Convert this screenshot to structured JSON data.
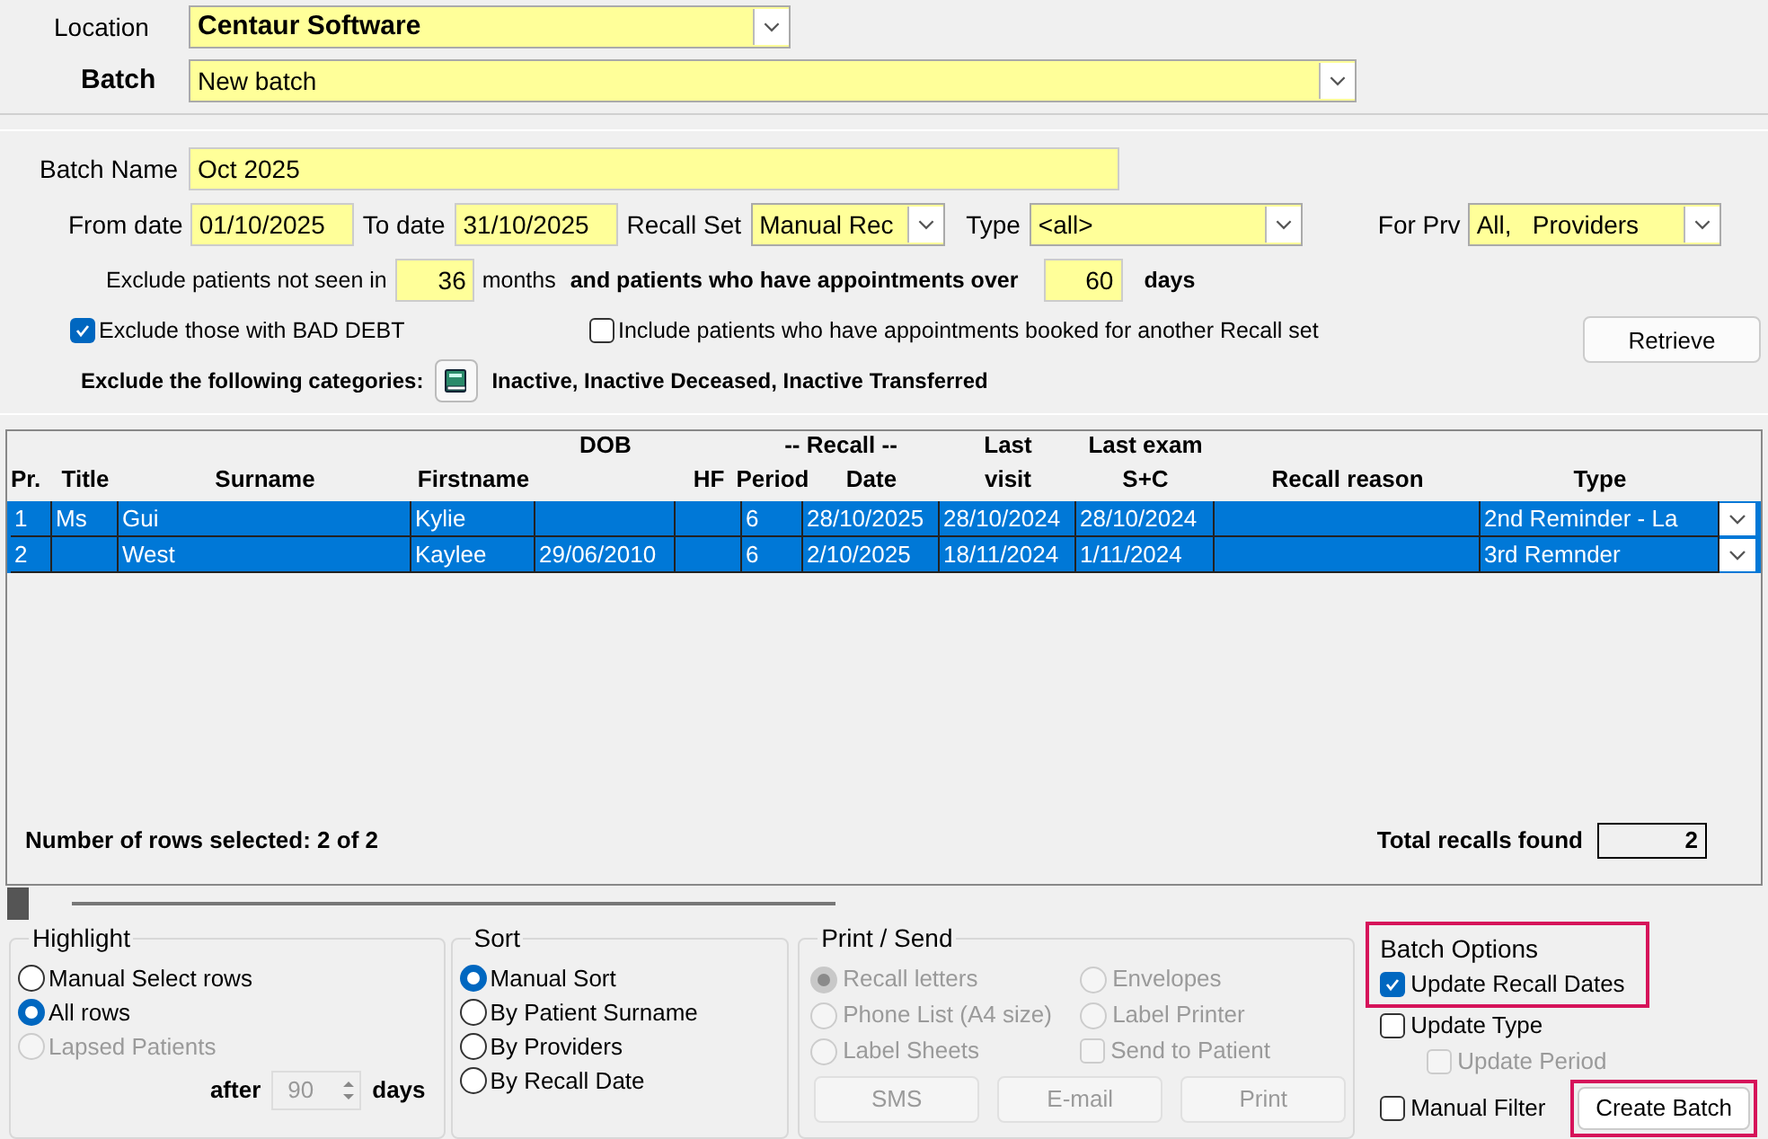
{
  "location": {
    "label": "Location",
    "value": "Centaur Software"
  },
  "batch": {
    "label": "Batch",
    "value": "New batch"
  },
  "batch_name": {
    "label": "Batch Name",
    "value": "Oct 2025"
  },
  "from_date": {
    "label": "From date",
    "value": "01/10/2025"
  },
  "to_date": {
    "label": "To date",
    "value": "31/10/2025"
  },
  "recall_set": {
    "label": "Recall Set",
    "value": "Manual Rec"
  },
  "type": {
    "label": "Type",
    "value": "<all>"
  },
  "for_prv": {
    "label": "For Prv",
    "value": "All,   Providers"
  },
  "exclude_not_seen": {
    "label": "Exclude patients not seen in",
    "value": "36",
    "unit": "months"
  },
  "appointments_over": {
    "label": "and patients who have appointments over",
    "value": "60",
    "unit": "days"
  },
  "bad_debt": {
    "label": "Exclude those with BAD DEBT",
    "checked": true
  },
  "other_recall_set": {
    "label": "Include patients who have appointments booked for another Recall set",
    "checked": false
  },
  "retrieve_button": "Retrieve",
  "categories": {
    "label": "Exclude the following categories:",
    "value": "Inactive, Inactive Deceased, Inactive Transferred"
  },
  "table": {
    "group_header": "-- Recall --",
    "columns": [
      {
        "label": "Pr."
      },
      {
        "label": "Title"
      },
      {
        "label": "Surname"
      },
      {
        "label": "Firstname"
      },
      {
        "top": "DOB"
      },
      {
        "label": "HF"
      },
      {
        "label": "Period"
      },
      {
        "label": "Date"
      },
      {
        "top": "Last",
        "label": "visit"
      },
      {
        "top": "Last exam",
        "label": "S+C"
      },
      {
        "label": "Recall reason"
      },
      {
        "label": "Type"
      }
    ],
    "rows": [
      {
        "selected": true,
        "cells": [
          "1",
          "Ms",
          "Gui",
          "Kylie",
          null,
          null,
          "6",
          "28/10/2025",
          "28/10/2024",
          "28/10/2024",
          null,
          "2nd Reminder - La"
        ]
      },
      {
        "selected": true,
        "cells": [
          "2",
          null,
          "West",
          "Kaylee",
          "29/06/2010",
          null,
          "6",
          "2/10/2025",
          "18/11/2024",
          "1/11/2024",
          null,
          "3rd Remnder"
        ]
      }
    ]
  },
  "rows_selected": "Number of rows selected: 2 of 2",
  "total_recalls": {
    "label": "Total recalls found",
    "value": "2"
  },
  "highlight": {
    "title": "Highlight",
    "options": [
      {
        "label": "Manual Select rows",
        "selected": false,
        "disabled": false
      },
      {
        "label": "All rows",
        "selected": true,
        "disabled": false
      },
      {
        "label": "Lapsed Patients",
        "selected": false,
        "disabled": true
      }
    ],
    "after_label": "after",
    "after_value": "90",
    "days_label": "days"
  },
  "sort": {
    "title": "Sort",
    "options": [
      {
        "label": "Manual Sort",
        "selected": true
      },
      {
        "label": "By Patient Surname",
        "selected": false
      },
      {
        "label": "By Providers",
        "selected": false
      },
      {
        "label": "By Recall Date",
        "selected": false
      }
    ]
  },
  "print_send": {
    "title": "Print / Send",
    "options": [
      {
        "kind": "radio",
        "label": "Recall letters",
        "selected": true
      },
      {
        "kind": "radio",
        "label": "Envelopes",
        "selected": false
      },
      {
        "kind": "radio",
        "label": "Phone List (A4 size)",
        "selected": false
      },
      {
        "kind": "radio",
        "label": "Label Printer",
        "selected": false
      },
      {
        "kind": "radio",
        "label": "Label Sheets",
        "selected": false
      },
      {
        "kind": "checkbox",
        "label": "Send to Patient",
        "selected": false
      }
    ],
    "buttons": [
      "SMS",
      "E-mail",
      "Print"
    ],
    "disabled": true
  },
  "batch_options": {
    "title": "Batch Options",
    "outlined": true,
    "options": [
      {
        "label": "Update Recall Dates",
        "checked": true,
        "disabled": false
      },
      {
        "label": "Update Type",
        "checked": false,
        "disabled": false,
        "children": [
          {
            "label": "Update Period",
            "checked": false,
            "disabled": true
          }
        ]
      },
      {
        "label": "Manual Filter",
        "checked": false,
        "disabled": false
      }
    ]
  },
  "create_batch": {
    "label": "Create Batch",
    "outlined": true
  }
}
